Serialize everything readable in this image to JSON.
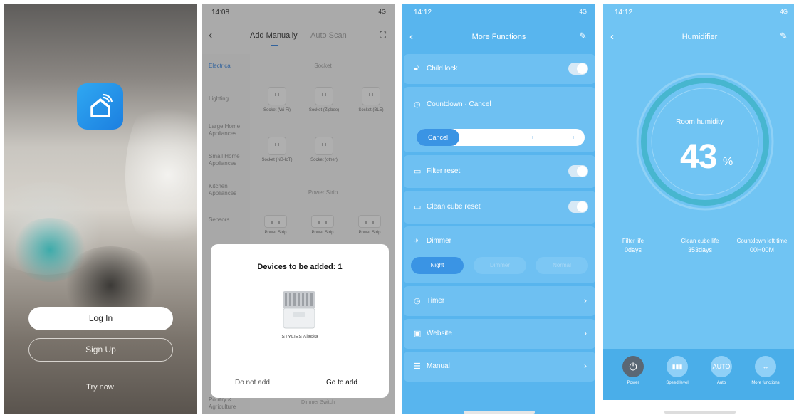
{
  "screen1": {
    "login": "Log In",
    "signup": "Sign Up",
    "try_now": "Try now"
  },
  "screen2": {
    "time": "14:08",
    "signal": "4G",
    "tab_manual": "Add Manually",
    "tab_auto": "Auto Scan",
    "categories": [
      "Electrical",
      "Lighting",
      "Large Home Appliances",
      "Small Home Appliances",
      "Kitchen Appliances",
      "Sensors",
      "Poultry & Agriculture"
    ],
    "section_socket": "Socket",
    "section_power_strip": "Power Strip",
    "socket_devices": [
      "Socket (Wi-Fi)",
      "Socket (Zigbee)",
      "Socket (BLE)",
      "Socket (NB-IoT)",
      "Socket (other)"
    ],
    "strip_devices": [
      "Power Strip",
      "Power Strip",
      "Power Strip"
    ],
    "bottom_section": "Dimmer Switch",
    "sheet_title": "Devices to be added: 1",
    "product_name": "STYLIES Alaska",
    "do_not_add": "Do not add",
    "go_to_add": "Go to add"
  },
  "screen3": {
    "time": "14:12",
    "signal": "4G",
    "title": "More Functions",
    "child_lock": "Child lock",
    "countdown": "Countdown",
    "countdown_cancel": "Cancel",
    "slider_value": "Cancel",
    "filter_reset": "Filter reset",
    "clean_cube_reset": "Clean cube reset",
    "dimmer": "Dimmer",
    "dimmer_options": [
      "Night",
      "Dimmer",
      "Normal"
    ],
    "timer": "Timer",
    "website": "Website",
    "manual": "Manual"
  },
  "screen4": {
    "time": "14:12",
    "signal": "4G",
    "title": "Humidifier",
    "room_humidity_label": "Room humidity",
    "humidity": 43,
    "humidity_text": "43",
    "unit": "%",
    "stats": [
      {
        "label": "Filter life",
        "value": "0days"
      },
      {
        "label": "Clean cube life",
        "value": "353days"
      },
      {
        "label": "Countdown left time",
        "value": "00H00M"
      }
    ],
    "controls": [
      {
        "label": "Power",
        "glyph": "⏻"
      },
      {
        "label": "Speed level",
        "glyph": "▮▮▮"
      },
      {
        "label": "Auto",
        "glyph": "AUTO"
      },
      {
        "label": "More functions",
        "glyph": "↔"
      }
    ]
  },
  "colors": {
    "brand_blue": "#2c7bd8",
    "panel_blue": "#58b5ee",
    "hum_blue": "#70c4f3",
    "ring_teal": "#47b6cf"
  }
}
